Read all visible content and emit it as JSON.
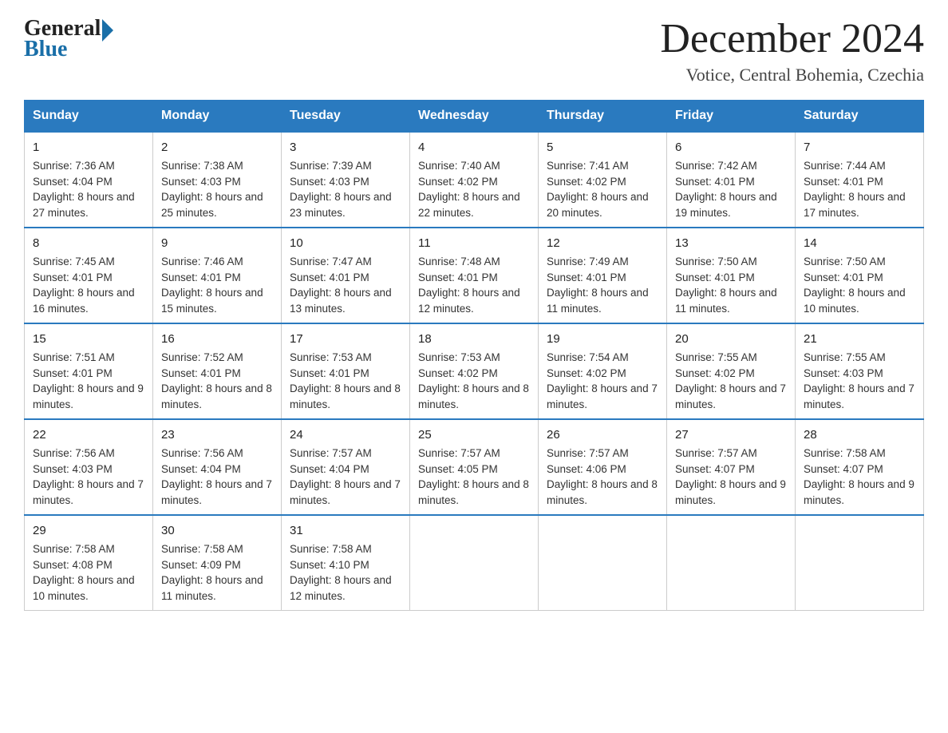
{
  "header": {
    "logo": {
      "general": "General",
      "blue": "Blue"
    },
    "title": "December 2024",
    "subtitle": "Votice, Central Bohemia, Czechia"
  },
  "days": [
    "Sunday",
    "Monday",
    "Tuesday",
    "Wednesday",
    "Thursday",
    "Friday",
    "Saturday"
  ],
  "weeks": [
    [
      {
        "day": 1,
        "sunrise": "7:36 AM",
        "sunset": "4:04 PM",
        "daylight": "8 hours and 27 minutes."
      },
      {
        "day": 2,
        "sunrise": "7:38 AM",
        "sunset": "4:03 PM",
        "daylight": "8 hours and 25 minutes."
      },
      {
        "day": 3,
        "sunrise": "7:39 AM",
        "sunset": "4:03 PM",
        "daylight": "8 hours and 23 minutes."
      },
      {
        "day": 4,
        "sunrise": "7:40 AM",
        "sunset": "4:02 PM",
        "daylight": "8 hours and 22 minutes."
      },
      {
        "day": 5,
        "sunrise": "7:41 AM",
        "sunset": "4:02 PM",
        "daylight": "8 hours and 20 minutes."
      },
      {
        "day": 6,
        "sunrise": "7:42 AM",
        "sunset": "4:01 PM",
        "daylight": "8 hours and 19 minutes."
      },
      {
        "day": 7,
        "sunrise": "7:44 AM",
        "sunset": "4:01 PM",
        "daylight": "8 hours and 17 minutes."
      }
    ],
    [
      {
        "day": 8,
        "sunrise": "7:45 AM",
        "sunset": "4:01 PM",
        "daylight": "8 hours and 16 minutes."
      },
      {
        "day": 9,
        "sunrise": "7:46 AM",
        "sunset": "4:01 PM",
        "daylight": "8 hours and 15 minutes."
      },
      {
        "day": 10,
        "sunrise": "7:47 AM",
        "sunset": "4:01 PM",
        "daylight": "8 hours and 13 minutes."
      },
      {
        "day": 11,
        "sunrise": "7:48 AM",
        "sunset": "4:01 PM",
        "daylight": "8 hours and 12 minutes."
      },
      {
        "day": 12,
        "sunrise": "7:49 AM",
        "sunset": "4:01 PM",
        "daylight": "8 hours and 11 minutes."
      },
      {
        "day": 13,
        "sunrise": "7:50 AM",
        "sunset": "4:01 PM",
        "daylight": "8 hours and 11 minutes."
      },
      {
        "day": 14,
        "sunrise": "7:50 AM",
        "sunset": "4:01 PM",
        "daylight": "8 hours and 10 minutes."
      }
    ],
    [
      {
        "day": 15,
        "sunrise": "7:51 AM",
        "sunset": "4:01 PM",
        "daylight": "8 hours and 9 minutes."
      },
      {
        "day": 16,
        "sunrise": "7:52 AM",
        "sunset": "4:01 PM",
        "daylight": "8 hours and 8 minutes."
      },
      {
        "day": 17,
        "sunrise": "7:53 AM",
        "sunset": "4:01 PM",
        "daylight": "8 hours and 8 minutes."
      },
      {
        "day": 18,
        "sunrise": "7:53 AM",
        "sunset": "4:02 PM",
        "daylight": "8 hours and 8 minutes."
      },
      {
        "day": 19,
        "sunrise": "7:54 AM",
        "sunset": "4:02 PM",
        "daylight": "8 hours and 7 minutes."
      },
      {
        "day": 20,
        "sunrise": "7:55 AM",
        "sunset": "4:02 PM",
        "daylight": "8 hours and 7 minutes."
      },
      {
        "day": 21,
        "sunrise": "7:55 AM",
        "sunset": "4:03 PM",
        "daylight": "8 hours and 7 minutes."
      }
    ],
    [
      {
        "day": 22,
        "sunrise": "7:56 AM",
        "sunset": "4:03 PM",
        "daylight": "8 hours and 7 minutes."
      },
      {
        "day": 23,
        "sunrise": "7:56 AM",
        "sunset": "4:04 PM",
        "daylight": "8 hours and 7 minutes."
      },
      {
        "day": 24,
        "sunrise": "7:57 AM",
        "sunset": "4:04 PM",
        "daylight": "8 hours and 7 minutes."
      },
      {
        "day": 25,
        "sunrise": "7:57 AM",
        "sunset": "4:05 PM",
        "daylight": "8 hours and 8 minutes."
      },
      {
        "day": 26,
        "sunrise": "7:57 AM",
        "sunset": "4:06 PM",
        "daylight": "8 hours and 8 minutes."
      },
      {
        "day": 27,
        "sunrise": "7:57 AM",
        "sunset": "4:07 PM",
        "daylight": "8 hours and 9 minutes."
      },
      {
        "day": 28,
        "sunrise": "7:58 AM",
        "sunset": "4:07 PM",
        "daylight": "8 hours and 9 minutes."
      }
    ],
    [
      {
        "day": 29,
        "sunrise": "7:58 AM",
        "sunset": "4:08 PM",
        "daylight": "8 hours and 10 minutes."
      },
      {
        "day": 30,
        "sunrise": "7:58 AM",
        "sunset": "4:09 PM",
        "daylight": "8 hours and 11 minutes."
      },
      {
        "day": 31,
        "sunrise": "7:58 AM",
        "sunset": "4:10 PM",
        "daylight": "8 hours and 12 minutes."
      },
      null,
      null,
      null,
      null
    ]
  ]
}
